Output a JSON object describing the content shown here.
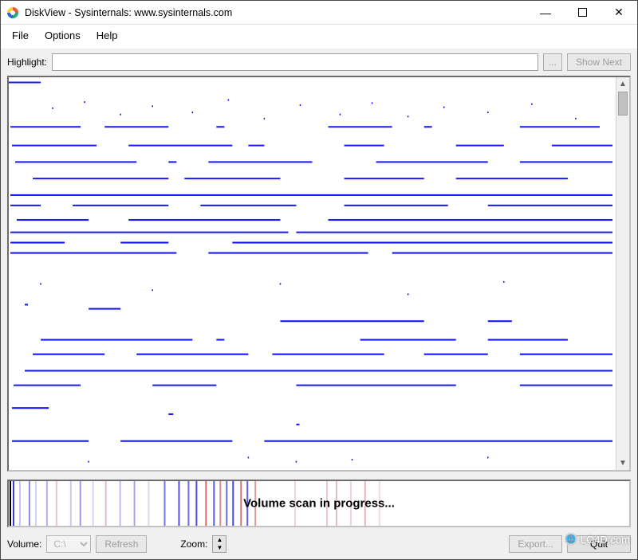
{
  "titlebar": {
    "app_name": "DiskView",
    "publisher": "Sysinternals: www.sysinternals.com",
    "title_text": "DiskView - Sysinternals: www.sysinternals.com"
  },
  "menu": {
    "file": "File",
    "options": "Options",
    "help": "Help"
  },
  "highlight": {
    "label": "Highlight:",
    "value": "",
    "placeholder": "",
    "browse_label": "...",
    "show_next_label": "Show Next"
  },
  "overview": {
    "status_text": "Volume scan in progress..."
  },
  "bottom": {
    "volume_label": "Volume:",
    "volume_value": "C:\\",
    "refresh_label": "Refresh",
    "zoom_label": "Zoom:",
    "export_label": "Export...",
    "quit_label": "Quit"
  },
  "watermark": "LO4D.com",
  "icons": {
    "minimize": "—",
    "maximize": "▭",
    "close": "✕",
    "up": "▲",
    "down": "▼"
  }
}
